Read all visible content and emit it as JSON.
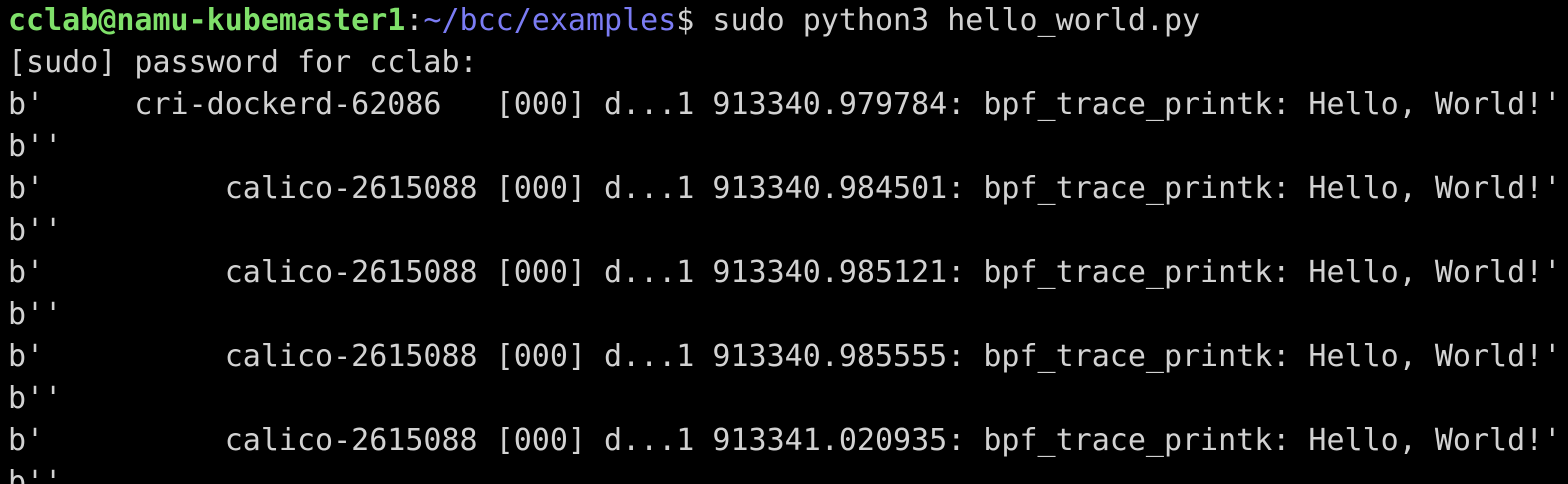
{
  "terminal": {
    "prompt": {
      "user_host": "cclab@namu-kubemaster1",
      "colon": ":",
      "path": "~/bcc/examples",
      "symbol": "$",
      "command": " sudo python3 hello_world.py"
    },
    "sudo_prompt": "[sudo] password for cclab:",
    "output_lines": [
      "b'     cri-dockerd-62086   [000] d...1 913340.979784: bpf_trace_printk: Hello, World!'",
      "b''",
      "b'          calico-2615088 [000] d...1 913340.984501: bpf_trace_printk: Hello, World!'",
      "b''",
      "b'          calico-2615088 [000] d...1 913340.985121: bpf_trace_printk: Hello, World!'",
      "b''",
      "b'          calico-2615088 [000] d...1 913340.985555: bpf_trace_printk: Hello, World!'",
      "b''",
      "b'          calico-2615088 [000] d...1 913341.020935: bpf_trace_printk: Hello, World!'",
      "b''"
    ]
  },
  "colors": {
    "background": "#000000",
    "text": "#d2d2d2",
    "user_host": "#7fe06a",
    "path": "#7b7cf4"
  }
}
